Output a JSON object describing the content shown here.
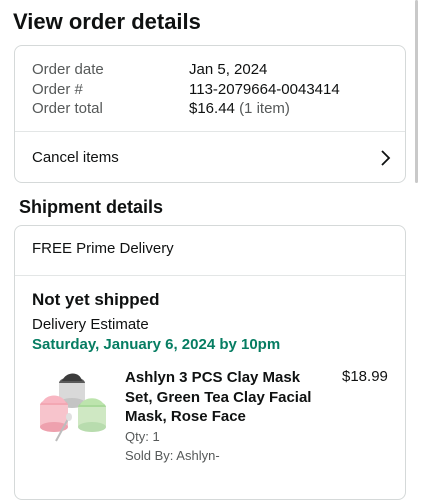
{
  "page": {
    "title": "View order details"
  },
  "summary": {
    "order_date_label": "Order date",
    "order_date": "Jan 5, 2024",
    "order_number_label": "Order #",
    "order_number": "113-2079664-0043414",
    "order_total_label": "Order total",
    "order_total": "$16.44",
    "item_count": "(1 item)",
    "cancel_label": "Cancel items",
    "cancel_icon": "chevron-right-icon"
  },
  "shipment": {
    "heading": "Shipment details",
    "method": "FREE Prime Delivery",
    "status": "Not yet shipped",
    "estimate_label": "Delivery Estimate",
    "estimate_date": "Saturday, January 6, 2024 by 10pm",
    "estimate_color": "#067d62",
    "item": {
      "title": "Ashlyn 3 PCS Clay Mask Set, Green Tea Clay Facial Mask, Rose Face",
      "price": "$18.99",
      "qty": "Qty: 1",
      "seller": "Sold By: Ashlyn-",
      "image_icon": "clay-mask-jars-image"
    }
  }
}
